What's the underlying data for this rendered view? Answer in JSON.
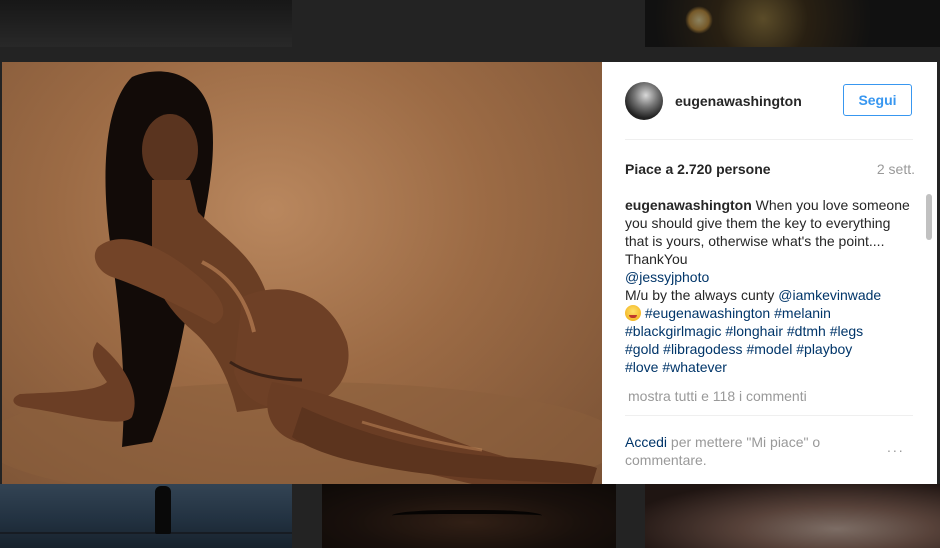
{
  "post": {
    "username": "eugenawashington",
    "follow_label": "Segui",
    "likes_text": "Piace a 2.720 persone",
    "time_ago": "2 sett.",
    "caption": {
      "user": "eugenawashington",
      "text1": " When you love someone you should give them the key to everything that is yours, otherwise what's the point.... ThankYou",
      "mention1": "@jessyjphoto",
      "text2": "M/u by the always cunty ",
      "mention2": "@iamkevinwade",
      "tags_line1": [
        "#eugenawashington",
        "#melanin"
      ],
      "tags_line2": [
        "#blackgirlmagic",
        "#longhair",
        "#dtmh",
        "#legs"
      ],
      "tags_line3": [
        "#gold",
        "#libragodess",
        "#model",
        "#playboy"
      ],
      "tags_line4": [
        "#love",
        "#whatever"
      ]
    },
    "show_all_comments": "mostra tutti e 118 i commenti",
    "footer": {
      "login_link": "Accedi",
      "login_text": " per mettere \"Mi piace\" o commentare.",
      "more_icon": "..."
    }
  },
  "icons": {
    "avatar": "avatar",
    "emoji": "tongue-emoji-icon",
    "more": "more-options-icon"
  },
  "colors": {
    "link": "#003569",
    "follow": "#3897f0",
    "muted": "#999999"
  }
}
